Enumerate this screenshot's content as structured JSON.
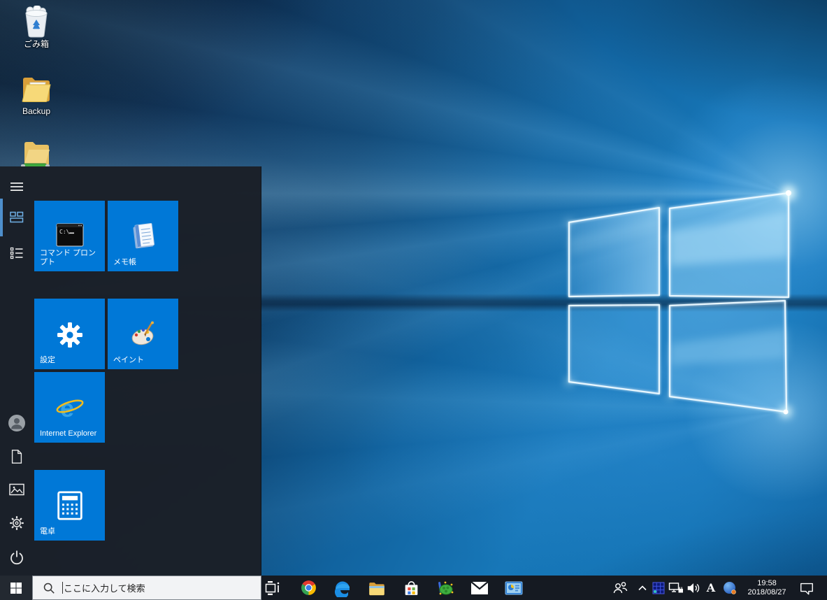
{
  "desktop": {
    "wallpaper": "windows-10-hero-blue",
    "icons": [
      {
        "id": "recycle-bin",
        "label": "ごみ箱"
      },
      {
        "id": "backup-folder",
        "label": "Backup"
      },
      {
        "id": "folder",
        "label": ""
      }
    ]
  },
  "start_menu": {
    "rail_items": [
      "menu",
      "pinned-tiles",
      "all-apps",
      "user",
      "documents",
      "pictures",
      "settings",
      "power"
    ],
    "selected_rail_item": "pinned-tiles",
    "tiles": [
      {
        "label": "コマンド プロンプト"
      },
      {
        "label": "メモ帳"
      },
      {
        "label": "設定"
      },
      {
        "label": "ペイント"
      },
      {
        "label": "Internet Explorer"
      },
      {
        "label": "電卓"
      }
    ]
  },
  "taskbar": {
    "search": {
      "placeholder": "ここに入力して検索"
    },
    "app_icons": [
      "start",
      "task-view",
      "chrome",
      "edge",
      "file-explorer",
      "microsoft-store",
      "turtle-app",
      "mail",
      "system-app"
    ],
    "tray": {
      "icons": [
        "people",
        "hidden-icons-chevron",
        "grid-app",
        "network",
        "volume",
        "ime-mode",
        "globe-app",
        "clock",
        "action-center"
      ],
      "ime_mode": "A",
      "clock": {
        "time": "19:58",
        "date": "2018/08/27"
      }
    }
  },
  "colors": {
    "tile_accent": "#0078d7",
    "menu_bg": "#1b2028",
    "taskbar_bg": "#151a22",
    "search_bg": "#f2f3f5",
    "rail_accent": "#4e8fcc"
  }
}
